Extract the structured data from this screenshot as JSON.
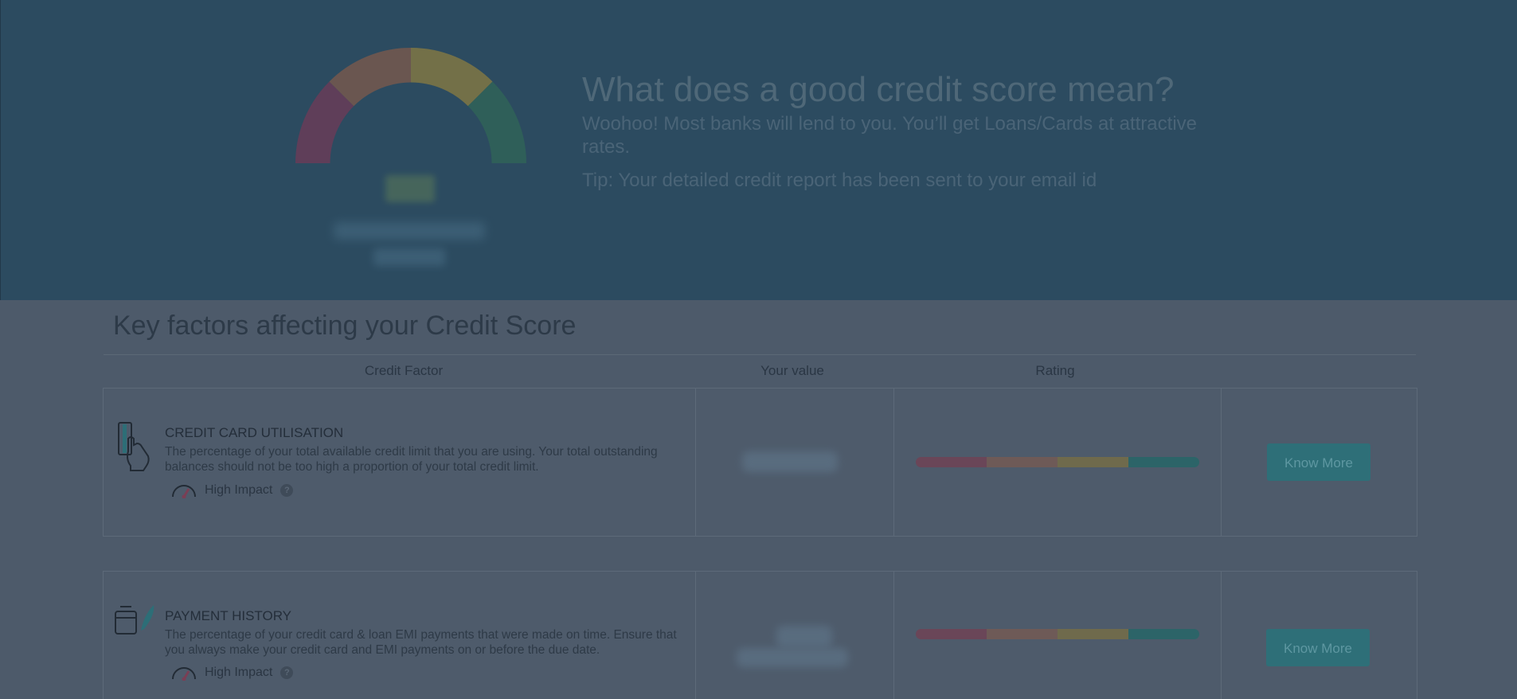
{
  "hero": {
    "title": "What does a good credit score mean?",
    "description": "Woohoo! Most banks will lend to you. You’ll get Loans/Cards at attractive rates.",
    "tip": "Tip: Your detailed credit report has been sent to your email id",
    "gauge_colors": [
      "#5f3e59",
      "#6a5650",
      "#737048",
      "#2f5f59"
    ]
  },
  "factors_section": {
    "title": "Key factors affecting your Credit Score",
    "columns": {
      "factor": "Credit Factor",
      "value": "Your value",
      "rating": "Rating"
    },
    "rating_colors": [
      "#6a4658",
      "#6e5a57",
      "#6f6a4c",
      "#2c6468"
    ],
    "items": [
      {
        "icon": "credit-card-hand-icon",
        "title": "CREDIT CARD UTILISATION",
        "description": "The percentage of your total available credit limit that you are using. Your total outstanding balances should not be too high a proportion of your total credit limit.",
        "impact": "High Impact",
        "button": "Know More"
      },
      {
        "icon": "payment-history-icon",
        "title": "PAYMENT HISTORY",
        "description": "The percentage of your credit card & loan EMI payments that were made on time. Ensure that you always make your credit card and EMI payments on or before the due date.",
        "impact": "High Impact",
        "button": "Know More"
      }
    ]
  }
}
